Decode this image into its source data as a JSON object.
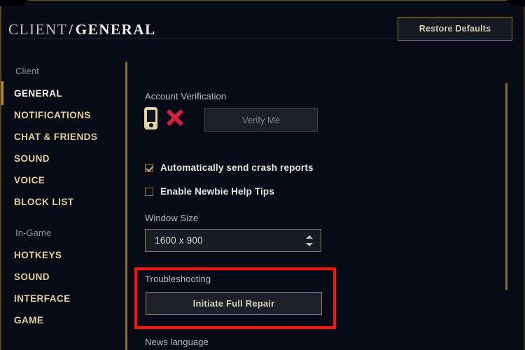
{
  "window": {
    "breadcrumb_root": "CLIENT",
    "breadcrumb_separator": "/",
    "breadcrumb_current": "GENERAL"
  },
  "header": {
    "restore_defaults_label": "Restore Defaults"
  },
  "sidebar": {
    "groups": [
      {
        "label": "Client",
        "items": [
          {
            "label": "GENERAL",
            "active": true
          },
          {
            "label": "NOTIFICATIONS",
            "active": false
          },
          {
            "label": "CHAT & FRIENDS",
            "active": false
          },
          {
            "label": "SOUND",
            "active": false
          },
          {
            "label": "VOICE",
            "active": false
          },
          {
            "label": "BLOCK LIST",
            "active": false
          }
        ]
      },
      {
        "label": "In-Game",
        "items": [
          {
            "label": "HOTKEYS",
            "active": false
          },
          {
            "label": "SOUND",
            "active": false
          },
          {
            "label": "INTERFACE",
            "active": false
          },
          {
            "label": "GAME",
            "active": false
          }
        ]
      }
    ]
  },
  "main": {
    "account_verification": {
      "label": "Account Verification",
      "phone_icon": "mobile-phone-icon",
      "status_icon": "red-x-icon",
      "verify_button_label": "Verify Me",
      "verify_button_enabled": false
    },
    "checkboxes": [
      {
        "label": "Automatically send crash reports",
        "checked": true
      },
      {
        "label": "Enable Newbie Help Tips",
        "checked": false
      }
    ],
    "window_size": {
      "label": "Window Size",
      "value": "1600 x 900",
      "stepper_icon": "up-down-chevrons-icon"
    },
    "troubleshooting": {
      "label": "Troubleshooting",
      "repair_button_label": "Initiate Full Repair",
      "highlighted": true
    },
    "news_language": {
      "label": "News language"
    }
  },
  "colors": {
    "background": "#060b15",
    "gold": "#9b7d3c",
    "gold_bright": "#b98e31",
    "text_primary": "#e9e6df",
    "text_muted": "#b9bdc4",
    "sidebar_item": "#e4cf9b",
    "highlight_red": "#fd1111",
    "status_red": "#d2213f"
  }
}
